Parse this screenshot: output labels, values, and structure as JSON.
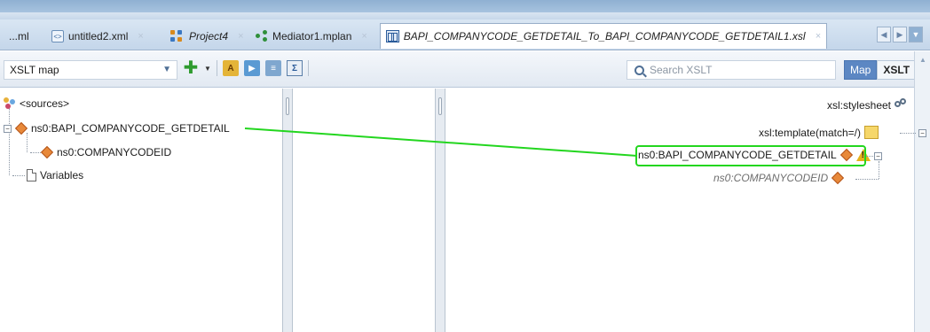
{
  "tabs": [
    {
      "label": "...ml"
    },
    {
      "label": "untitled2.xml"
    },
    {
      "label": "Project4"
    },
    {
      "label": "Mediator1.mplan"
    },
    {
      "label": "BAPI_COMPANYCODE_GETDETAIL_To_BAPI_COMPANYCODE_GETDETAIL1.xsl"
    }
  ],
  "toolbar": {
    "view_combo": "XSLT map",
    "search_placeholder": "Search XSLT",
    "view_map": "Map",
    "view_xslt": "XSLT"
  },
  "source_tree": {
    "root": "<sources>",
    "element": "ns0:BAPI_COMPANYCODE_GETDETAIL",
    "child": "ns0:COMPANYCODEID",
    "variables": "Variables"
  },
  "target_tree": {
    "stylesheet": "xsl:stylesheet",
    "template": "xsl:template(match=/)",
    "element": "ns0:BAPI_COMPANYCODE_GETDETAIL",
    "child": "ns0:COMPANYCODEID"
  },
  "colors": {
    "mapping_line": "#23d61f",
    "accent": "#5c87c3"
  }
}
